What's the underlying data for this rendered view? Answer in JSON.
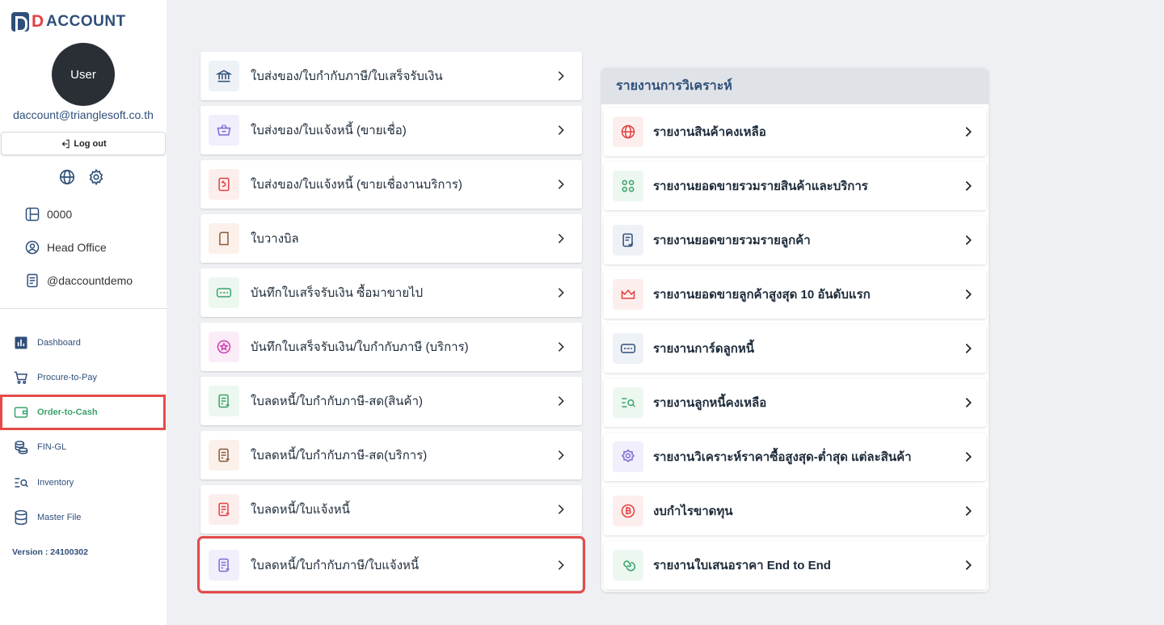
{
  "brand": {
    "mark": "D",
    "name": "ACCOUNT"
  },
  "user": {
    "avatar_label": "User",
    "email": "daccount@trianglesoft.co.th",
    "logout_label": "Log out"
  },
  "company": {
    "code": "0000",
    "branch": "Head Office",
    "handle": "@daccountdemo"
  },
  "nav": {
    "items": [
      {
        "label": "Dashboard",
        "icon": "bar-chart-icon"
      },
      {
        "label": "Procure-to-Pay",
        "icon": "cart-icon"
      },
      {
        "label": "Order-to-Cash",
        "icon": "wallet-icon",
        "active": true
      },
      {
        "label": "FIN-GL",
        "icon": "coins-icon"
      },
      {
        "label": "Inventory",
        "icon": "list-search-icon"
      },
      {
        "label": "Master File",
        "icon": "database-icon"
      }
    ],
    "version": "Version : 24100302"
  },
  "documents": [
    {
      "label": "ใบส่งของ/ใบกำกับภาษี/ใบเสร็จรับเงิน",
      "icon": "bank-icon",
      "color": "#2f4f7a",
      "bg": "#eef1f6"
    },
    {
      "label": "ใบส่งของ/ใบแจ้งหนี้ (ขายเชื่อ)",
      "icon": "basket-icon",
      "color": "#7b6ad6",
      "bg": "#f1effb"
    },
    {
      "label": "ใบส่งของ/ใบแจ้งหนี้ (ขายเชื่องานบริการ)",
      "icon": "receipt-return-icon",
      "color": "#e34040",
      "bg": "#fdeeee"
    },
    {
      "label": "ใบวางบิล",
      "icon": "note-icon",
      "color": "#8a5a3c",
      "bg": "#fbf1ea"
    },
    {
      "label": "บันทึกใบเสร็จรับเงิน ซื้อมาขายไป",
      "icon": "card-icon",
      "color": "#3aa36b",
      "bg": "#ecf7f0"
    },
    {
      "label": "บันทึกใบเสร็จรับเงิน/ใบกำกับภาษี (บริการ)",
      "icon": "star-circle-icon",
      "color": "#d23fb2",
      "bg": "#fbedf7"
    },
    {
      "label": "ใบลดหนี้/ใบกำกับภาษี-สด(สินค้า)",
      "icon": "doc-minus-icon",
      "color": "#3aa36b",
      "bg": "#ecf7f0"
    },
    {
      "label": "ใบลดหนี้/ใบกำกับภาษี-สด(บริการ)",
      "icon": "doc-minus-icon",
      "color": "#8a5a3c",
      "bg": "#fbf1ea"
    },
    {
      "label": "ใบลดหนี้/ใบแจ้งหนี้",
      "icon": "doc-minus-icon",
      "color": "#e34040",
      "bg": "#fdeeee"
    },
    {
      "label": "ใบลดหนี้/ใบกำกับภาษี/ใบแจ้งหนี้",
      "icon": "doc-minus-icon",
      "color": "#7b6ad6",
      "bg": "#f1effb",
      "highlight": true
    }
  ],
  "reports": {
    "title": "รายงานการวิเคราะห์",
    "items": [
      {
        "label": "รายงานสินค้าคงเหลือ",
        "icon": "globe-icon",
        "color": "#e34040",
        "bg": "#fdeeee"
      },
      {
        "label": "รายงานยอดขายรวมรายสินค้าและบริการ",
        "icon": "grid-circles-icon",
        "color": "#3aa36b",
        "bg": "#ecf7f0"
      },
      {
        "label": "รายงานยอดขายรวมรายลูกค้า",
        "icon": "doc-check-icon",
        "color": "#2f4f7a",
        "bg": "#eef1f6"
      },
      {
        "label": "รายงานยอดขายลูกค้าสูงสุด 10 อันดับแรก",
        "icon": "crown-icon",
        "color": "#e34040",
        "bg": "#fdeeee"
      },
      {
        "label": "รายงานการ์ดลูกหนี้",
        "icon": "card-icon",
        "color": "#2f4f7a",
        "bg": "#eef1f6"
      },
      {
        "label": "รายงานลูกหนี้คงเหลือ",
        "icon": "list-search-icon",
        "color": "#3aa36b",
        "bg": "#ecf7f0"
      },
      {
        "label": "รายงานวิเคราะห์ราคาซื้อสูงสุด-ต่ำสุด แต่ละสินค้า",
        "icon": "badge-icon",
        "color": "#7b6ad6",
        "bg": "#f1effb"
      },
      {
        "label": "งบกำไรขาดทุน",
        "icon": "bitcoin-icon",
        "color": "#e34040",
        "bg": "#fdeeee"
      },
      {
        "label": "รายงานใบเสนอราคา End to End",
        "icon": "spiral-icon",
        "color": "#3aa36b",
        "bg": "#ecf7f0"
      }
    ]
  }
}
